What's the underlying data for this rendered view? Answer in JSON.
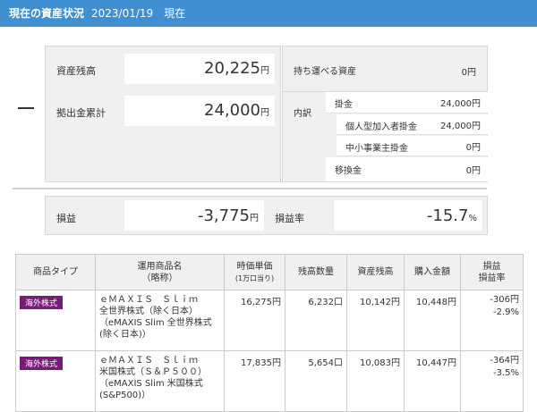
{
  "header": {
    "title": "現在の資産状況",
    "date": "2023/01/19",
    "now": "現在"
  },
  "summary": {
    "asset_balance_label": "資産残高",
    "asset_balance": "20,225",
    "contribution_total_label": "拠出金累計",
    "contribution_total": "24,000",
    "unit": "円",
    "portable_label": "持ち運べる資産",
    "portable_value": "0",
    "breakdown_label": "内訳",
    "breakdown": [
      {
        "label": "掛金",
        "value": "24,000"
      },
      {
        "label": "個人型加入者掛金",
        "value": "24,000"
      },
      {
        "label": "中小事業主掛金",
        "value": "0"
      },
      {
        "label": "移換金",
        "value": "0"
      }
    ]
  },
  "profit": {
    "label": "損益",
    "value": "-3,775",
    "unit": "円",
    "rate_label": "損益率",
    "rate_value": "-15.7",
    "rate_unit": "%"
  },
  "table": {
    "headers": {
      "type": "商品タイプ",
      "name": "運用商品名",
      "name_sub": "（略称）",
      "price": "時価単価",
      "price_sub": "(1万口当り)",
      "qty": "残高数量",
      "balance": "資産残高",
      "cost": "購入金額",
      "pl": "損益",
      "pl_rate": "損益率"
    },
    "rows": [
      {
        "type": "海外株式",
        "name_line1": "ｅＭＡＸＩＳ　Ｓｌｉｍ",
        "name_line2": "全世界株式（除く日本）",
        "name_line3": "（eMAXIS Slim 全世界株式",
        "name_line4": "(除く日本)）",
        "price": "16,275",
        "qty": "6,232",
        "balance": "10,142",
        "cost": "10,448",
        "pl": "-306",
        "pl_rate": "-2.9"
      },
      {
        "type": "海外株式",
        "name_line1": "ｅＭＡＸＩＳ　Ｓｌｉｍ",
        "name_line2": "米国株式（Ｓ＆Ｐ５００）",
        "name_line3": "（eMAXIS Slim 米国株式",
        "name_line4": "(S&P500)）",
        "price": "17,835",
        "qty": "5,654",
        "balance": "10,083",
        "cost": "10,447",
        "pl": "-364",
        "pl_rate": "-3.5"
      }
    ],
    "yen": "円",
    "kuchi": "口",
    "pct": "%"
  }
}
